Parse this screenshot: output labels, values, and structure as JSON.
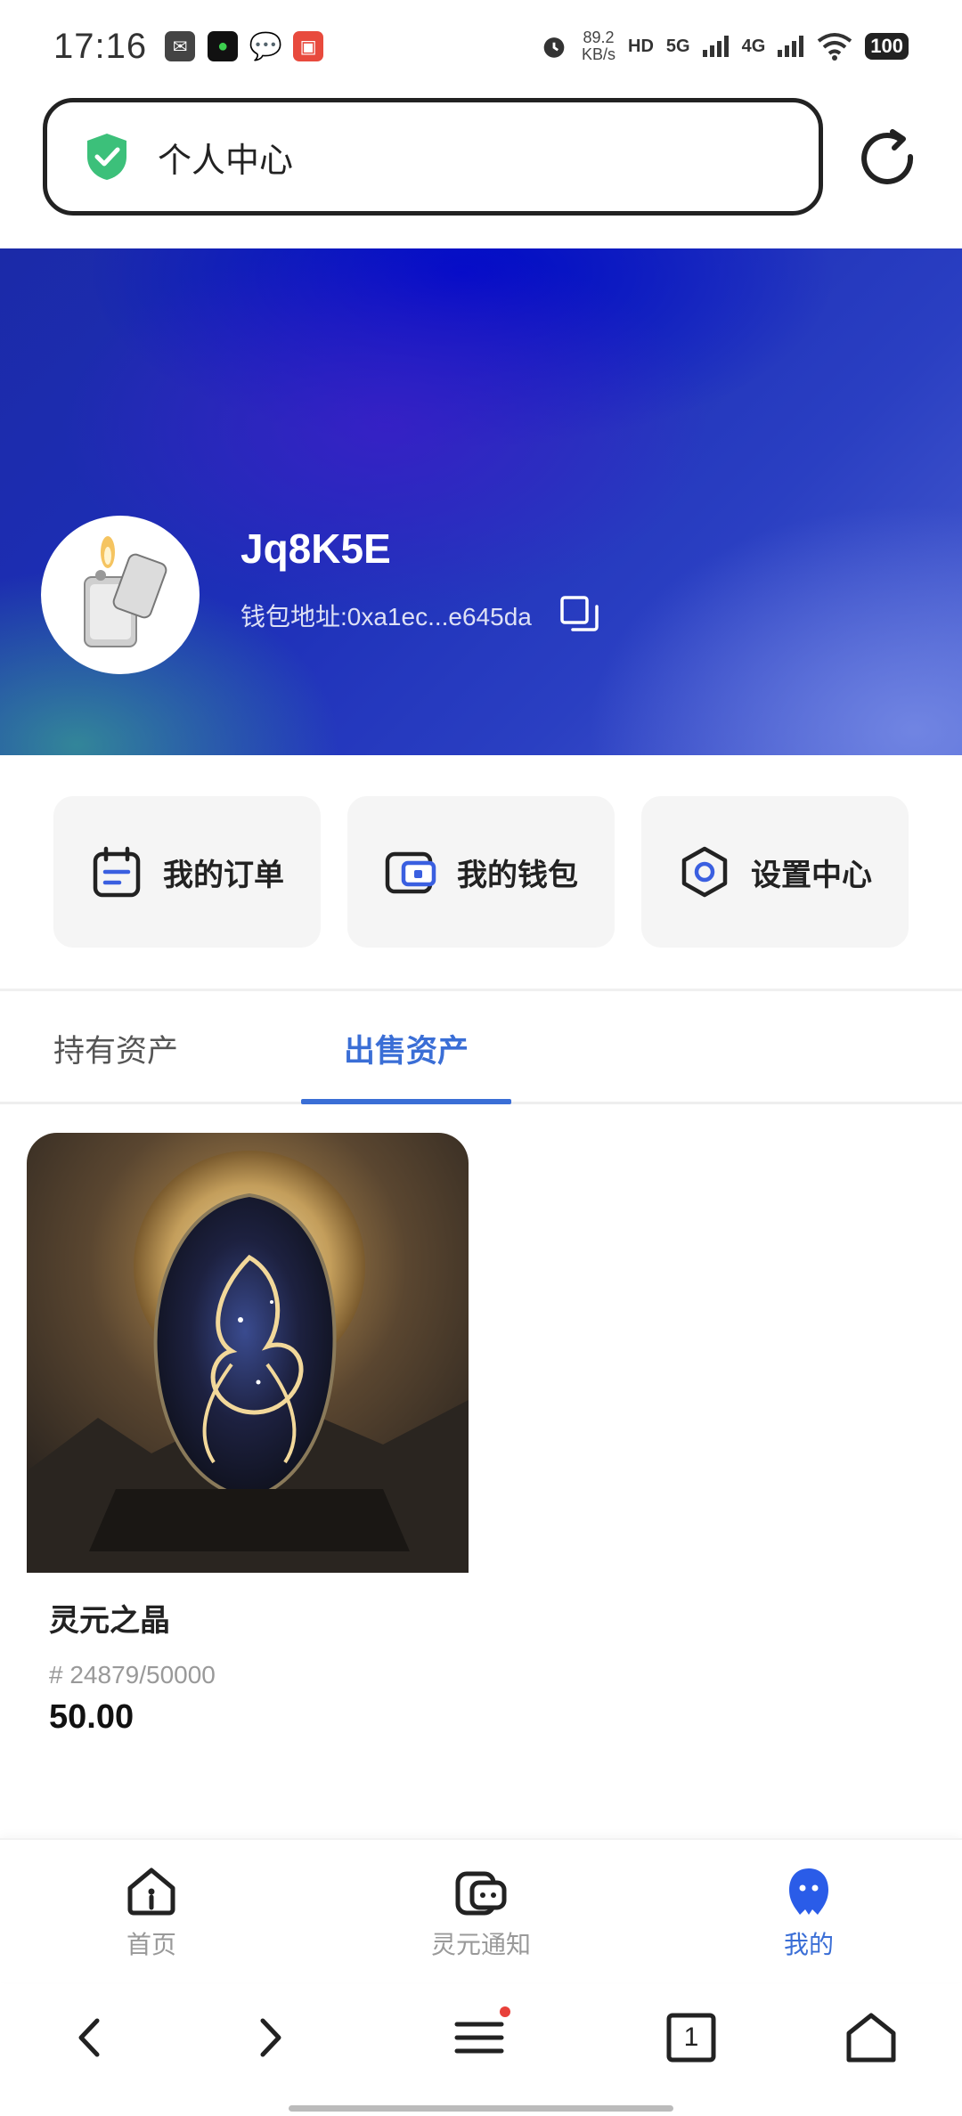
{
  "status_bar": {
    "time": "17:16",
    "net_speed_value": "89.2",
    "net_speed_unit": "KB/s",
    "hd_label": "HD",
    "signal_5g": "5G",
    "signal_4g": "4G",
    "battery": "100"
  },
  "address_bar": {
    "title": "个人中心",
    "shield_color": "#3cc07a"
  },
  "profile": {
    "username": "Jq8K5E",
    "wallet_address": "钱包地址:0xa1ec...e645da"
  },
  "actions": [
    {
      "label": "我的订单",
      "icon": "order-calendar-icon"
    },
    {
      "label": "我的钱包",
      "icon": "wallet-icon"
    },
    {
      "label": "设置中心",
      "icon": "hexagon-settings-icon"
    }
  ],
  "tabs": {
    "holding": "持有资产",
    "selling": "出售资产",
    "selected": "selling"
  },
  "assets": [
    {
      "name": "灵元之晶",
      "serial": "# 24879/50000",
      "price": "50.00"
    }
  ],
  "bottom_nav": {
    "home": "首页",
    "notice": "灵元通知",
    "mine": "我的",
    "active": "mine",
    "accent_color": "#3a6ed6"
  },
  "browser_nav": {
    "tab_count": "1"
  }
}
